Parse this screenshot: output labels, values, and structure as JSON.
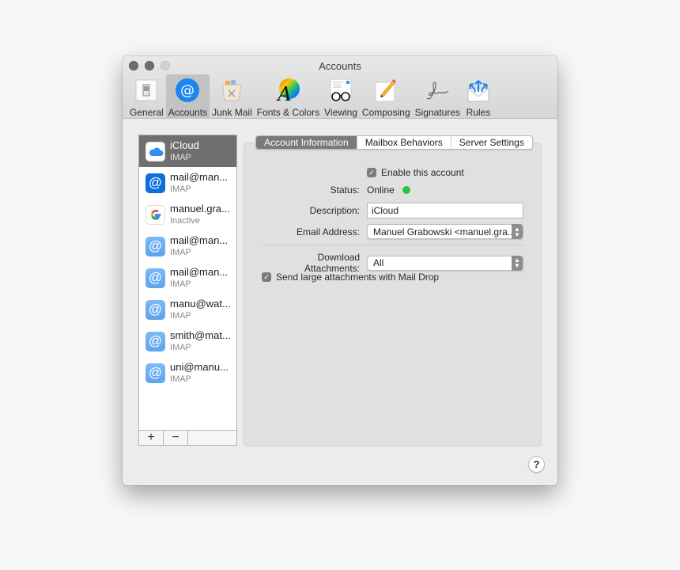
{
  "window": {
    "title": "Accounts"
  },
  "toolbar": {
    "items": [
      {
        "id": "general",
        "label": "General",
        "icon": "general-switch-icon",
        "active": false
      },
      {
        "id": "accounts",
        "label": "Accounts",
        "icon": "at-sign-icon",
        "active": true
      },
      {
        "id": "junk",
        "label": "Junk Mail",
        "icon": "trash-bin-icon",
        "active": false
      },
      {
        "id": "fonts",
        "label": "Fonts & Colors",
        "icon": "font-color-wheel-icon",
        "active": false
      },
      {
        "id": "viewing",
        "label": "Viewing",
        "icon": "glasses-icon",
        "active": false
      },
      {
        "id": "composing",
        "label": "Composing",
        "icon": "pencil-paper-icon",
        "active": false
      },
      {
        "id": "signatures",
        "label": "Signatures",
        "icon": "signature-icon",
        "active": false
      },
      {
        "id": "rules",
        "label": "Rules",
        "icon": "envelope-arrows-icon",
        "active": false
      }
    ]
  },
  "accounts": [
    {
      "name": "iCloud",
      "type": "IMAP",
      "icon": "icloud-icon",
      "selected": true
    },
    {
      "name": "mail@man...",
      "type": "IMAP",
      "icon": "at-sign-dark-icon",
      "selected": false
    },
    {
      "name": "manuel.gra...",
      "type": "Inactive",
      "icon": "google-icon",
      "selected": false
    },
    {
      "name": "mail@man...",
      "type": "IMAP",
      "icon": "at-sign-light-icon",
      "selected": false
    },
    {
      "name": "mail@man...",
      "type": "IMAP",
      "icon": "at-sign-light-icon",
      "selected": false
    },
    {
      "name": "manu@wat...",
      "type": "IMAP",
      "icon": "at-sign-light-icon",
      "selected": false
    },
    {
      "name": "smith@mat...",
      "type": "IMAP",
      "icon": "at-sign-light-icon",
      "selected": false
    },
    {
      "name": "uni@manu...",
      "type": "IMAP",
      "icon": "at-sign-light-icon",
      "selected": false
    }
  ],
  "list_buttons": {
    "add": "+",
    "remove": "−"
  },
  "tabs": [
    {
      "label": "Account Information",
      "active": true
    },
    {
      "label": "Mailbox Behaviors",
      "active": false
    },
    {
      "label": "Server Settings",
      "active": false
    }
  ],
  "form": {
    "enable_account": {
      "label": "Enable this account",
      "checked": true
    },
    "status": {
      "label": "Status:",
      "value": "Online",
      "color": "#2ac33f"
    },
    "description": {
      "label": "Description:",
      "value": "iCloud"
    },
    "email_address": {
      "label": "Email Address:",
      "value": "Manuel Grabowski <manuel.gra..."
    },
    "download_attachments": {
      "label": "Download Attachments:",
      "value": "All"
    },
    "mail_drop": {
      "label": "Send large attachments with Mail Drop",
      "checked": true
    }
  },
  "help": {
    "label": "?"
  },
  "colors": {
    "accent": "#1b86f0",
    "selected_row": "#6f6f6f",
    "status_online": "#2ac33f"
  }
}
